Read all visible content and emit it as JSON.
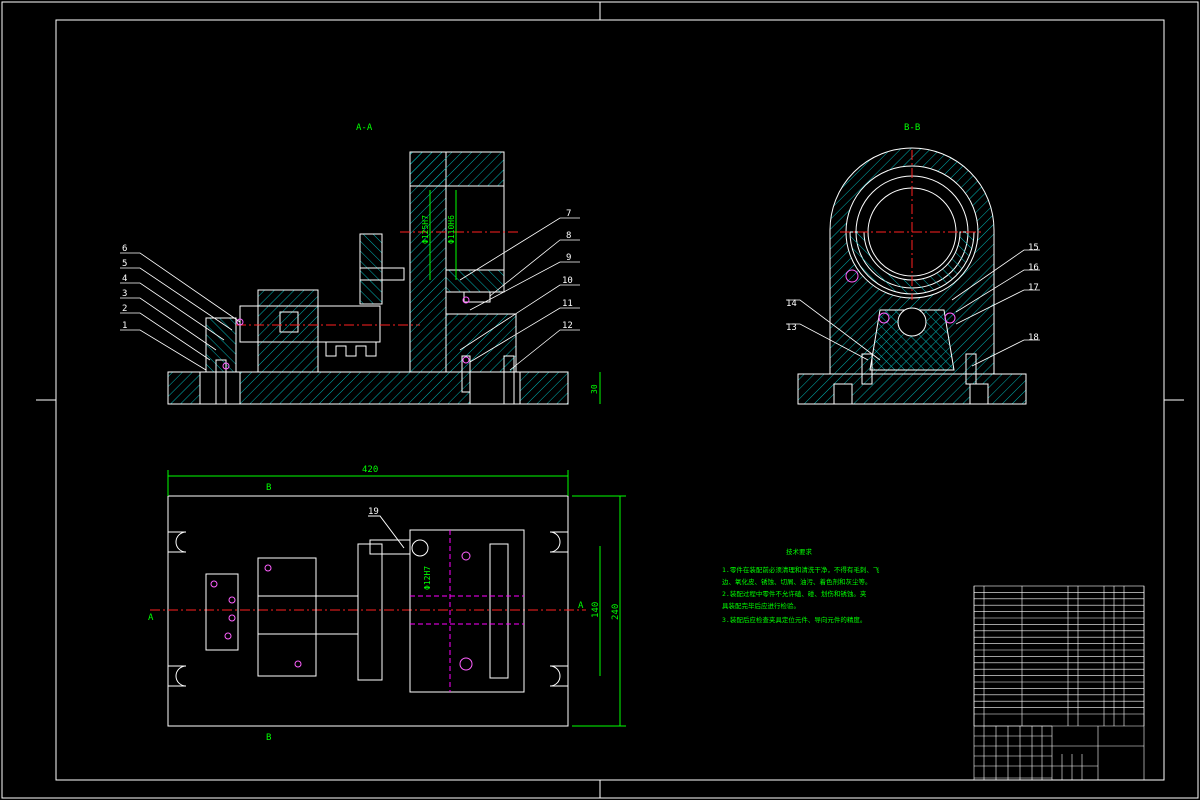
{
  "colors": {
    "background": "#000000",
    "outline": "#ffffff",
    "hatch": "#00b4b4",
    "centerline": "#ff2020",
    "dimension": "#00ff00",
    "hidden": "#ff00ff",
    "bolt": "#ff60ff"
  },
  "views": {
    "section_aa_title": "A-A",
    "section_bb_title": "B-B",
    "section_a_marker": "A",
    "section_b_marker": "B"
  },
  "dimensions": {
    "overall_length": "420",
    "overall_width": "240",
    "inner_width": "140",
    "base_height": "30",
    "bore_1": "Φ125H7",
    "bore_2": "Φ110H6",
    "pin_dia": "Φ12H7"
  },
  "part_callouts": [
    "1",
    "2",
    "3",
    "4",
    "5",
    "6",
    "7",
    "8",
    "9",
    "10",
    "11",
    "12",
    "13",
    "14",
    "15",
    "16",
    "17",
    "18",
    "19"
  ],
  "technical_notes": {
    "heading": "技术要求",
    "lines": [
      "1.零件在装配前必须清理和清洗干净，不得有毛刺、飞",
      "边、氧化皮、锈蚀、切屑、油污、着色剂和灰尘等。",
      "2.装配过程中零件不允许磕、碰、划伤和锈蚀。夹",
      "具装配完毕后应进行检验。",
      "3.装配后应检查夹具定位元件、导向元件的精度。"
    ]
  }
}
